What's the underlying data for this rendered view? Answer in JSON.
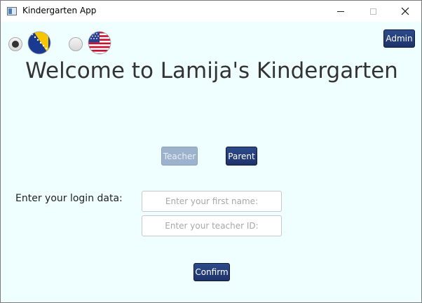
{
  "window": {
    "title": "Kindergarten App",
    "controls": {
      "minimize": "minimize-icon",
      "maximize": "maximize-icon",
      "close": "close-icon"
    }
  },
  "language": {
    "options": [
      {
        "flag": "bosnia-flag-icon",
        "selected": true
      },
      {
        "flag": "usa-flag-icon",
        "selected": false
      }
    ]
  },
  "header": {
    "admin_label": "Admin",
    "welcome": "Welcome to Lamija's Kindergarten"
  },
  "roles": {
    "teacher_label": "Teacher",
    "parent_label": "Parent"
  },
  "login": {
    "label": "Enter your login data:",
    "first_name_placeholder": "Enter your first name:",
    "teacher_id_placeholder": "Enter your teacher ID:",
    "confirm_label": "Confirm"
  },
  "colors": {
    "content_bg": "#efffff",
    "dark_button": "#233d7a",
    "disabled_button": "#9db2cc"
  }
}
